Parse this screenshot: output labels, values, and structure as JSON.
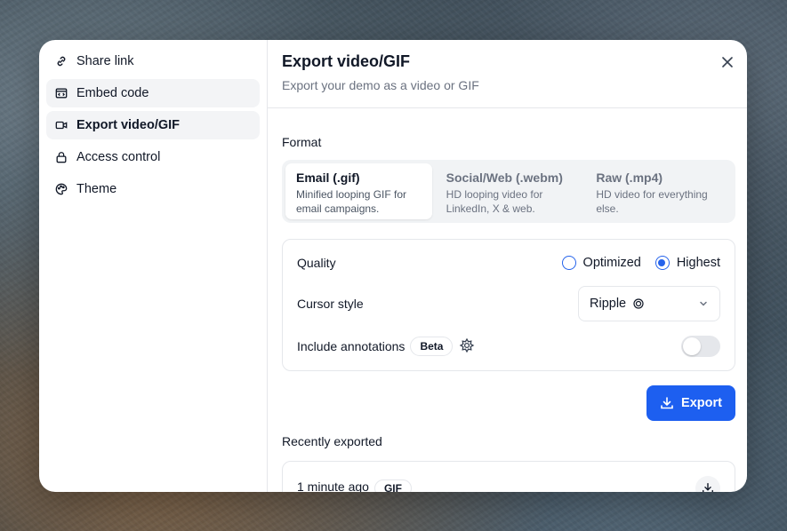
{
  "sidebar": {
    "items": [
      {
        "label": "Share link",
        "icon": "link-icon"
      },
      {
        "label": "Embed code",
        "icon": "embed-icon"
      },
      {
        "label": "Export video/GIF",
        "icon": "video-icon"
      },
      {
        "label": "Access control",
        "icon": "lock-icon"
      },
      {
        "label": "Theme",
        "icon": "palette-icon"
      }
    ]
  },
  "header": {
    "title": "Export video/GIF",
    "subtitle": "Export your demo as a video or GIF"
  },
  "format": {
    "label": "Format",
    "options": [
      {
        "title": "Email (.gif)",
        "desc": "Minified looping GIF for email campaigns.",
        "selected": true
      },
      {
        "title": "Social/Web (.webm)",
        "desc": "HD looping video for LinkedIn, X & web.",
        "selected": false
      },
      {
        "title": "Raw (.mp4)",
        "desc": "HD video for everything else.",
        "selected": false
      }
    ]
  },
  "settings": {
    "quality_label": "Quality",
    "quality_options": [
      "Optimized",
      "Highest"
    ],
    "quality_selected": "Highest",
    "cursor_label": "Cursor style",
    "cursor_value": "Ripple",
    "annotations_label": "Include annotations",
    "annotations_badge": "Beta",
    "annotations_enabled": false
  },
  "actions": {
    "export_label": "Export"
  },
  "recent": {
    "label": "Recently exported",
    "items": [
      {
        "time": "1 minute ago",
        "type": "GIF"
      }
    ]
  },
  "colors": {
    "accent": "#1d5ff0"
  }
}
